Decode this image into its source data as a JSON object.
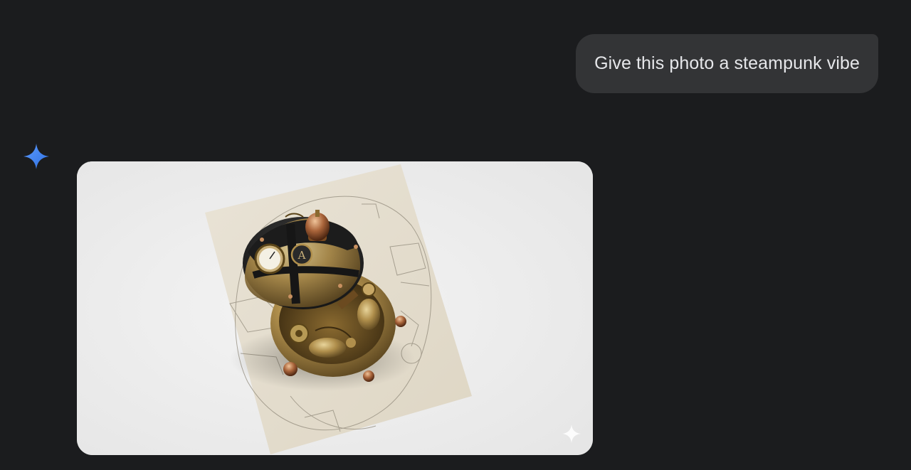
{
  "conversation": {
    "user_message": {
      "text": "Give this photo a steampunk vibe"
    },
    "assistant": {
      "avatar_icon": "gemini-sparkle-icon",
      "image": {
        "subject": "steampunk brass compact case on a blueprint",
        "watermark_icon": "sparkle-watermark-icon"
      }
    }
  },
  "colors": {
    "background": "#1b1c1e",
    "user_bubble": "#333436",
    "user_text": "#e6e7ea",
    "gemini_blue": "#4a8cf7"
  }
}
